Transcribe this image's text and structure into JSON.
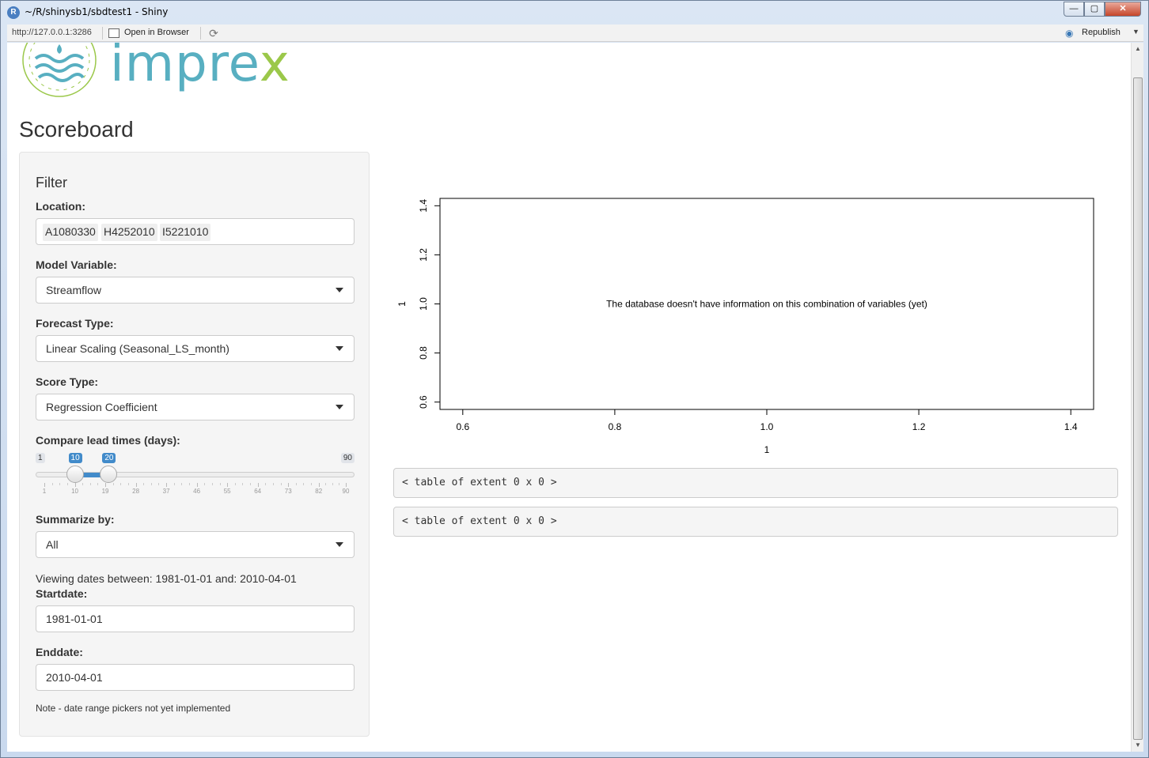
{
  "window": {
    "title": "~/R/shinysb1/sbdtest1 - Shiny",
    "min_glyph": "—",
    "max_glyph": "▢",
    "close_glyph": "✕"
  },
  "toolbar": {
    "url": "http://127.0.0.1:3286",
    "open_in_browser": "Open in Browser",
    "republish": "Republish"
  },
  "brand": {
    "name_main": "impre",
    "name_x": "x"
  },
  "page": {
    "title": "Scoreboard"
  },
  "sidebar": {
    "heading": "Filter",
    "location": {
      "label": "Location:",
      "chips": [
        "A1080330",
        "H4252010",
        "I5221010"
      ]
    },
    "model_variable": {
      "label": "Model Variable:",
      "value": "Streamflow"
    },
    "forecast_type": {
      "label": "Forecast Type:",
      "value": "Linear Scaling (Seasonal_LS_month)"
    },
    "score_type": {
      "label": "Score Type:",
      "value": "Regression Coefficient"
    },
    "lead_times": {
      "label": "Compare lead times (days):",
      "min": 1,
      "max": 90,
      "from": 10,
      "to": 20,
      "min_label": "1",
      "max_label": "90",
      "from_label": "10",
      "to_label": "20",
      "ticks": [
        "1",
        "10",
        "19",
        "28",
        "37",
        "46",
        "55",
        "64",
        "73",
        "82",
        "90"
      ]
    },
    "summarize_by": {
      "label": "Summarize by:",
      "value": "All"
    },
    "dates_text": "Viewing dates between: 1981-01-01 and: 2010-04-01",
    "startdate": {
      "label": "Startdate:",
      "value": "1981-01-01"
    },
    "enddate": {
      "label": "Enddate:",
      "value": "2010-04-01"
    },
    "note": "Note - date range pickers not yet implemented"
  },
  "chart_data": {
    "type": "scatter",
    "x": [],
    "y": [],
    "xlim": [
      0.57,
      1.43
    ],
    "ylim": [
      0.57,
      1.43
    ],
    "xticks": [
      "0.6",
      "0.8",
      "1.0",
      "1.2",
      "1.4"
    ],
    "yticks": [
      "0.6",
      "0.8",
      "1.0",
      "1.2",
      "1.4"
    ],
    "xlabel": "1",
    "ylabel": "1",
    "annotation": "The database doesn't have information on this combination of variables (yet)"
  },
  "tables": [
    "< table of extent 0 x 0 >",
    "< table of extent 0 x 0 >"
  ],
  "colors": {
    "brand_blue": "#58afc1",
    "brand_green": "#9bc84a",
    "slider_blue": "#428bca"
  }
}
